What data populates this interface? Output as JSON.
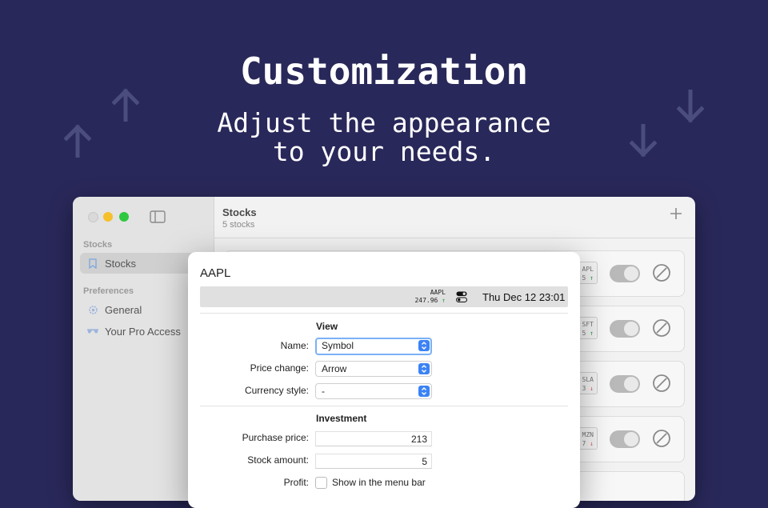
{
  "hero": {
    "title": "Customization",
    "subtitle_line1": "Adjust the appearance",
    "subtitle_line2": "to your needs."
  },
  "colors": {
    "background": "#29285a",
    "deco_arrow": "#4a4d7e",
    "accent_blue": "#3b82f6",
    "up_green": "#2aa148",
    "down_red": "#e05a5a"
  },
  "sidebar": {
    "section_stocks": "Stocks",
    "item_stocks": "Stocks",
    "section_preferences": "Preferences",
    "item_general": "General",
    "item_pro": "Your Pro Access"
  },
  "main": {
    "title": "Stocks",
    "subtitle": "5 stocks",
    "add_icon": "plus-icon",
    "cards": [
      {
        "ticker": "APL",
        "change": "5",
        "trend": "up"
      },
      {
        "ticker": "SFT",
        "change": "5",
        "trend": "up"
      },
      {
        "ticker": "SLA",
        "change": "3",
        "trend": "down"
      },
      {
        "ticker": "MZN",
        "change": "7",
        "trend": "down"
      }
    ]
  },
  "dialog": {
    "title": "AAPL",
    "menubar": {
      "ticker": "AAPL",
      "price": "247.96",
      "trend_arrow": "↑",
      "datetime": "Thu Dec 12  23:01"
    },
    "view_section": "View",
    "name_label": "Name:",
    "name_value": "Symbol",
    "price_change_label": "Price change:",
    "price_change_value": "Arrow",
    "currency_label": "Currency style:",
    "currency_value": "-",
    "investment_section": "Investment",
    "purchase_label": "Purchase price:",
    "purchase_value": "213",
    "amount_label": "Stock amount:",
    "amount_value": "5",
    "profit_label": "Profit:",
    "profit_option": "Show in the menu bar"
  }
}
